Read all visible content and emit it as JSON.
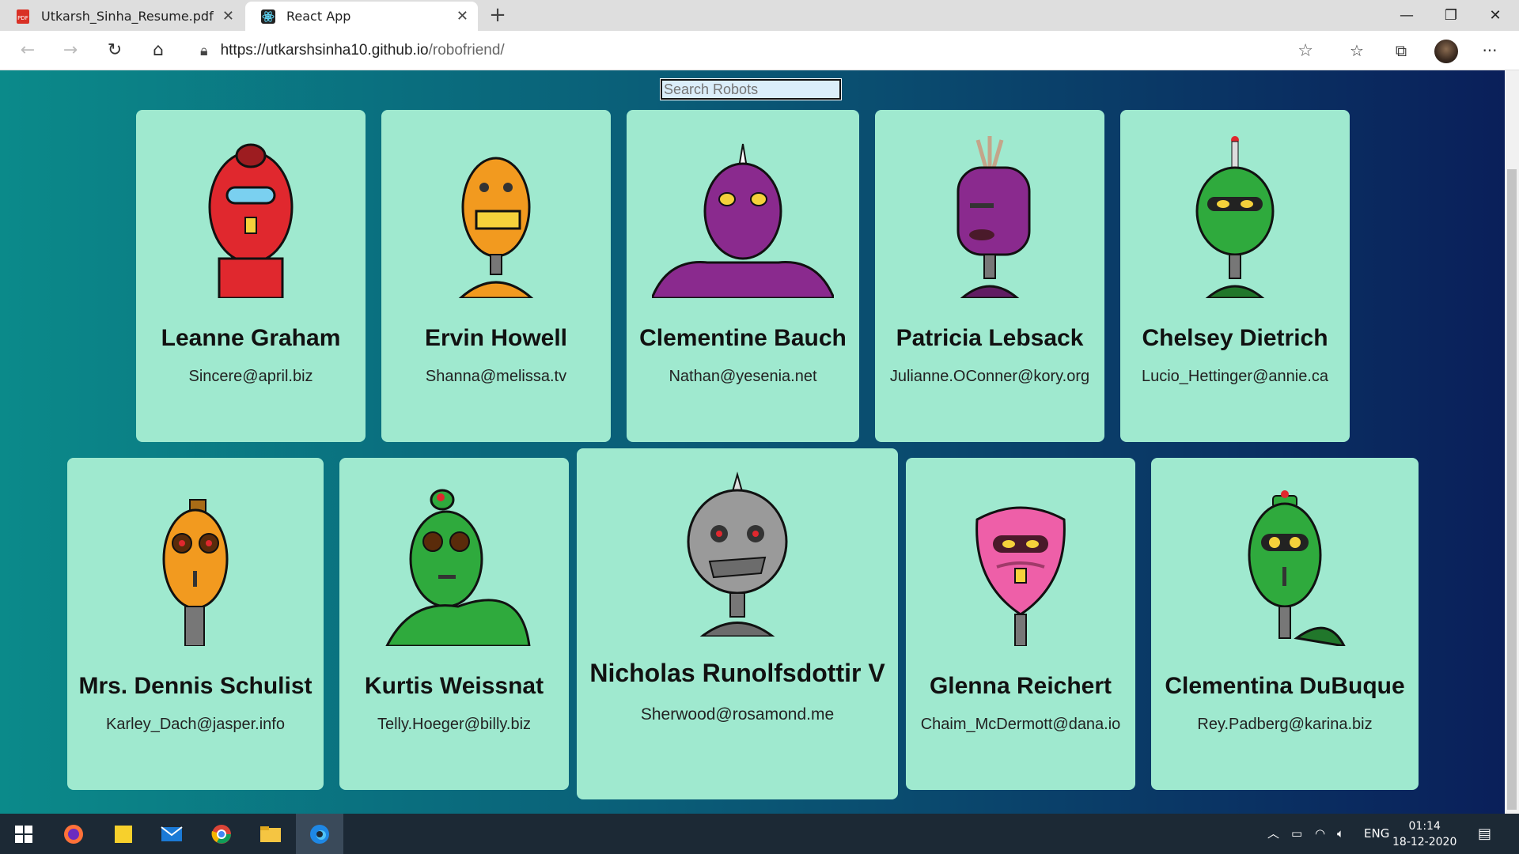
{
  "browser": {
    "tabs": [
      {
        "title": "Utkarsh_Sinha_Resume.pdf",
        "icon": "pdf-icon"
      },
      {
        "title": "React App",
        "icon": "react-icon"
      }
    ],
    "url_host": "https://utkarshsinha10.github.io",
    "url_path": "/robofriend/"
  },
  "search": {
    "placeholder": "Search Robots"
  },
  "robots": [
    {
      "name": "Leanne Graham",
      "email": "Sincere@april.biz",
      "color": "#e0282e"
    },
    {
      "name": "Ervin Howell",
      "email": "Shanna@melissa.tv",
      "color": "#f29a1f"
    },
    {
      "name": "Clementine Bauch",
      "email": "Nathan@yesenia.net",
      "color": "#8a2a8e"
    },
    {
      "name": "Patricia Lebsack",
      "email": "Julianne.OConner@kory.org",
      "color": "#8a2a8e"
    },
    {
      "name": "Chelsey Dietrich",
      "email": "Lucio_Hettinger@annie.ca",
      "color": "#2faa3d"
    },
    {
      "name": "Mrs. Dennis Schulist",
      "email": "Karley_Dach@jasper.info",
      "color": "#f29a1f"
    },
    {
      "name": "Kurtis Weissnat",
      "email": "Telly.Hoeger@billy.biz",
      "color": "#2faa3d"
    },
    {
      "name": "Nicholas Runolfsdottir V",
      "email": "Sherwood@rosamond.me",
      "color": "#9a9a9a"
    },
    {
      "name": "Glenna Reichert",
      "email": "Chaim_McDermott@dana.io",
      "color": "#ee5fa8"
    },
    {
      "name": "Clementina DuBuque",
      "email": "Rey.Padberg@karina.biz",
      "color": "#2faa3d"
    }
  ],
  "taskbar": {
    "lang": "ENG",
    "time": "01:14",
    "date": "18-12-2020"
  }
}
